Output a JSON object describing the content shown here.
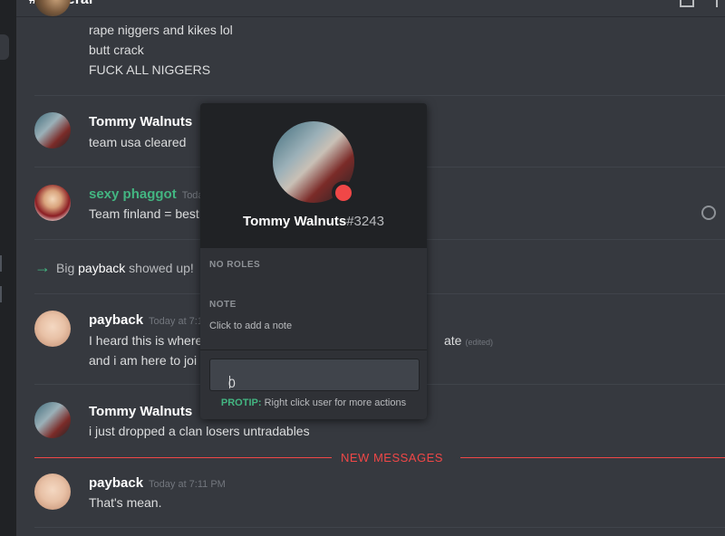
{
  "channel": {
    "title": "# general"
  },
  "messages": [
    {
      "lines": [
        "rape niggers and kikes lol",
        "butt crack",
        "FUCK ALL NIGGERS"
      ]
    },
    {
      "username": "Tommy Walnuts",
      "lines": [
        "team usa cleared"
      ]
    },
    {
      "username": "sexy phaggot",
      "username_color": "#43b581",
      "timestamp": "Today",
      "lines": [
        "Team finland = best"
      ]
    },
    {
      "username": "payback",
      "timestamp": "Today at 7:1",
      "lines": [
        "I heard this is where",
        "and i am here to joi"
      ],
      "line_tail": "ate",
      "edited": "(edited)"
    },
    {
      "username": "Tommy Walnuts",
      "lines": [
        "i just dropped a clan losers untradables"
      ]
    },
    {
      "username": "payback",
      "timestamp": "Today at 7:11 PM",
      "lines": [
        "That's mean."
      ]
    }
  ],
  "join": {
    "prefix": "Big",
    "who": "payback",
    "suffix": "showed up!"
  },
  "new_messages_label": "NEW MESSAGES",
  "popout": {
    "username": "Tommy Walnuts",
    "discriminator": "#3243",
    "status_color": "#f04747",
    "roles_header": "NO ROLES",
    "note_header": "NOTE",
    "note_placeholder": "Click to add a note",
    "message_value": "0",
    "protip_label": "PROTIP:",
    "protip_text": "Right click user for more actions"
  }
}
